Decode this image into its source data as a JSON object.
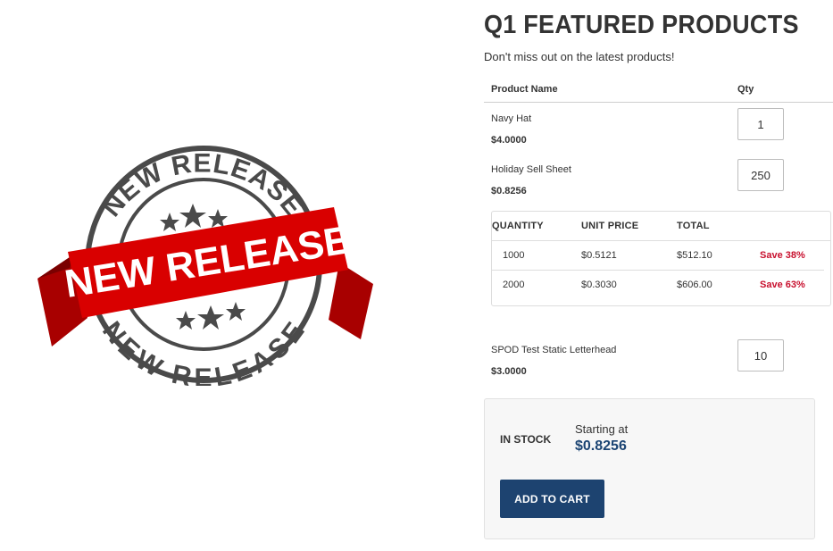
{
  "promo_image": {
    "arc_top_text": "NEW RELEASE",
    "ribbon_text": "NEW RELEASE",
    "arc_bottom_text": "NEW RELEASE",
    "ribbon_color": "#d90000",
    "ring_color": "#4a4a4a"
  },
  "header": {
    "title": "Q1 FEATURED PRODUCTS",
    "subtitle": "Don't miss out on the latest products!"
  },
  "table": {
    "col_name": "Product Name",
    "col_qty": "Qty"
  },
  "products": [
    {
      "name": "Navy Hat",
      "price": "$4.0000",
      "qty": "1"
    },
    {
      "name": "Holiday Sell Sheet",
      "price": "$0.8256",
      "qty": "250"
    },
    {
      "name": "SPOD Test Static Letterhead",
      "price": "$3.0000",
      "qty": "10"
    }
  ],
  "price_tiers": {
    "headers": [
      "QUANTITY",
      "UNIT PRICE",
      "TOTAL"
    ],
    "rows": [
      {
        "quantity": "1000",
        "unit_price": "$0.5121",
        "total": "$512.10",
        "save": "Save 38%"
      },
      {
        "quantity": "2000",
        "unit_price": "$0.3030",
        "total": "$606.00",
        "save": "Save 63%"
      }
    ]
  },
  "cart": {
    "stock_status": "IN STOCK",
    "starting_label": "Starting at",
    "starting_price": "$0.8256",
    "button_label": "ADD TO CART"
  },
  "colors": {
    "accent": "#1d4370",
    "save_red": "#c8102e"
  }
}
